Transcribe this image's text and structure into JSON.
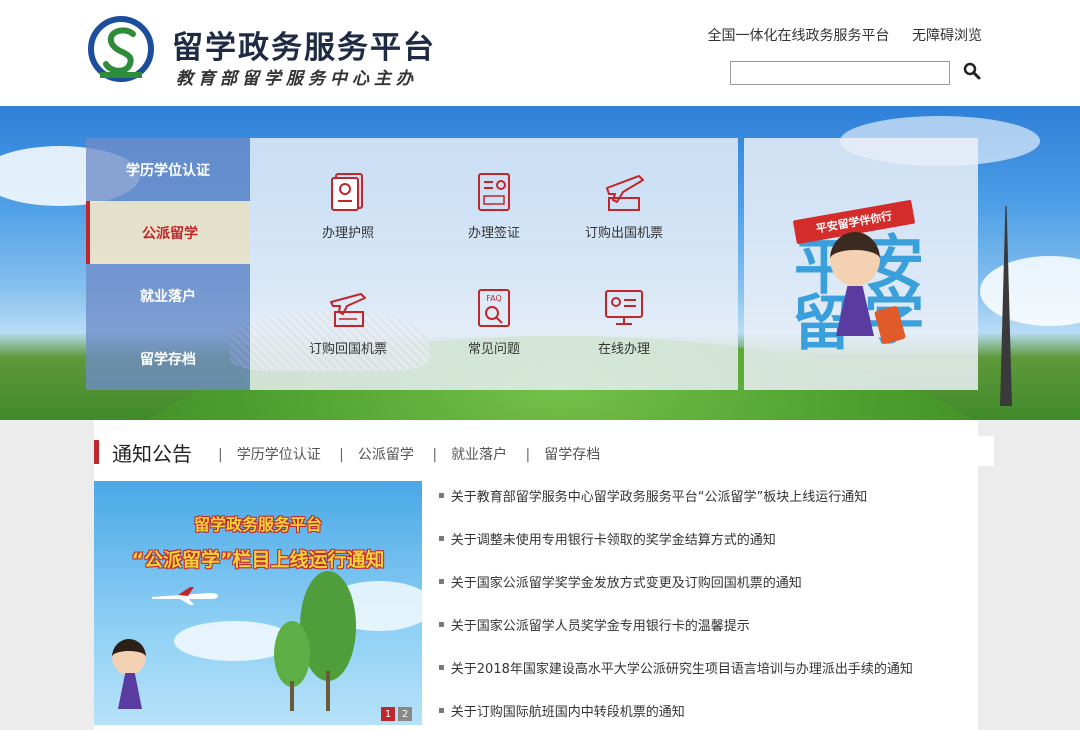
{
  "header": {
    "title": "留学政务服务平台",
    "subtitle": "教育部留学服务中心主办",
    "links": [
      "全国一体化在线政务服务平台",
      "无障碍浏览"
    ],
    "search_placeholder": ""
  },
  "side_menu": {
    "items": [
      {
        "label": "学历学位认证",
        "active": false
      },
      {
        "label": "公派留学",
        "active": true
      },
      {
        "label": "就业落户",
        "active": false
      },
      {
        "label": "留学存档",
        "active": false
      }
    ]
  },
  "services": [
    {
      "label": "办理护照",
      "icon": "passport-icon"
    },
    {
      "label": "办理签证",
      "icon": "visa-icon"
    },
    {
      "label": "订购出国机票",
      "icon": "plane-ticket-icon"
    },
    {
      "label": "订购回国机票",
      "icon": "return-ticket-icon"
    },
    {
      "label": "常见问题",
      "icon": "faq-icon"
    },
    {
      "label": "在线办理",
      "icon": "online-service-icon"
    }
  ],
  "promo": {
    "flag_text": "平安留学伴你行",
    "big_chars": [
      "平",
      "安",
      "留",
      "学"
    ]
  },
  "notice": {
    "title": "通知公告",
    "tabs": [
      "学历学位认证",
      "公派留学",
      "就业落户",
      "留学存档"
    ],
    "image_title_1": "留学政务服务平台",
    "image_title_2": "“公派留学”栏目上线运行通知",
    "pager": [
      "1",
      "2"
    ],
    "items": [
      "关于教育部留学服务中心留学政务服务平台“公派留学”板块上线运行通知",
      "关于调整未使用专用银行卡领取的奖学金结算方式的通知",
      "关于国家公派留学奖学金发放方式变更及订购回国机票的通知",
      "关于国家公派留学人员奖学金专用银行卡的温馨提示",
      "关于2018年国家建设高水平大学公派研究生项目语言培训与办理派出手续的通知",
      "关于订购国际航班国内中转段机票的通知"
    ]
  },
  "colors": {
    "accent_red": "#c0272d",
    "logo_blue": "#1b4f9c",
    "logo_green": "#2e8b3a"
  }
}
